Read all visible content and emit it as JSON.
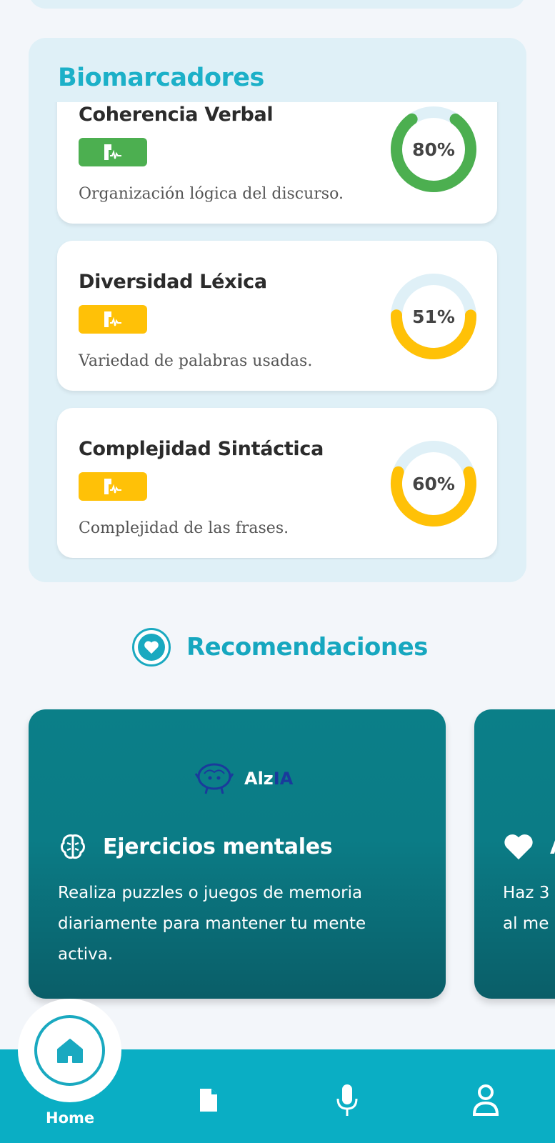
{
  "biomarkers": {
    "title": "Biomarcadores",
    "items": [
      {
        "name": "Coherencia Verbal",
        "description": "Organización lógica del discurso.",
        "percent": 80,
        "percent_label": "80%",
        "color": "#4caf50"
      },
      {
        "name": "Diversidad Léxica",
        "description": "Variedad de palabras usadas.",
        "percent": 51,
        "percent_label": "51%",
        "color": "#ffc107"
      },
      {
        "name": "Complejidad Sintáctica",
        "description": "Complejidad de las frases.",
        "percent": 60,
        "percent_label": "60%",
        "color": "#ffc107"
      }
    ]
  },
  "recommendations": {
    "title": "Recomendaciones",
    "cards": [
      {
        "logo_main": "Alz",
        "logo_accent": "IA",
        "title": "Ejercicios mentales",
        "icon": "brain-icon",
        "body": "Realiza puzzles o juegos de memoria diariamente para mantener tu mente activa."
      },
      {
        "title": "A",
        "icon": "heart-icon",
        "body_line1": "Haz 3",
        "body_line2": "al me"
      }
    ]
  },
  "nav": {
    "home_label": "Home",
    "items": [
      "home-icon",
      "document-icon",
      "microphone-icon",
      "profile-icon"
    ]
  },
  "colors": {
    "accent": "#1aa9c0",
    "nav_bg": "#0aaec4",
    "card_teal": "#0b7f88",
    "good": "#4caf50",
    "warn": "#ffc107"
  }
}
